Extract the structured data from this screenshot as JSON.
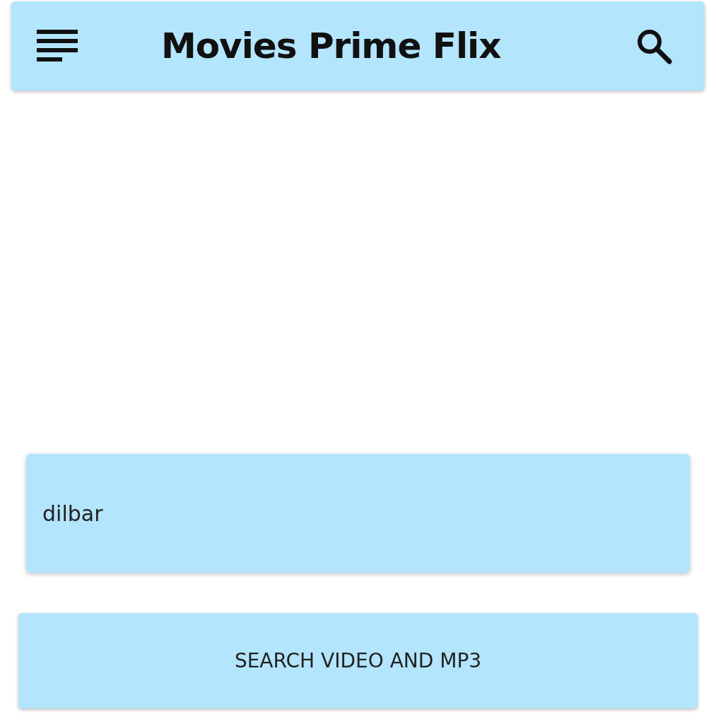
{
  "app_bar": {
    "title": "Movies Prime Flix"
  },
  "search_field": {
    "value": "dilbar"
  },
  "buttons": [
    {
      "label": "SEARCH VIDEO AND MP3"
    }
  ]
}
